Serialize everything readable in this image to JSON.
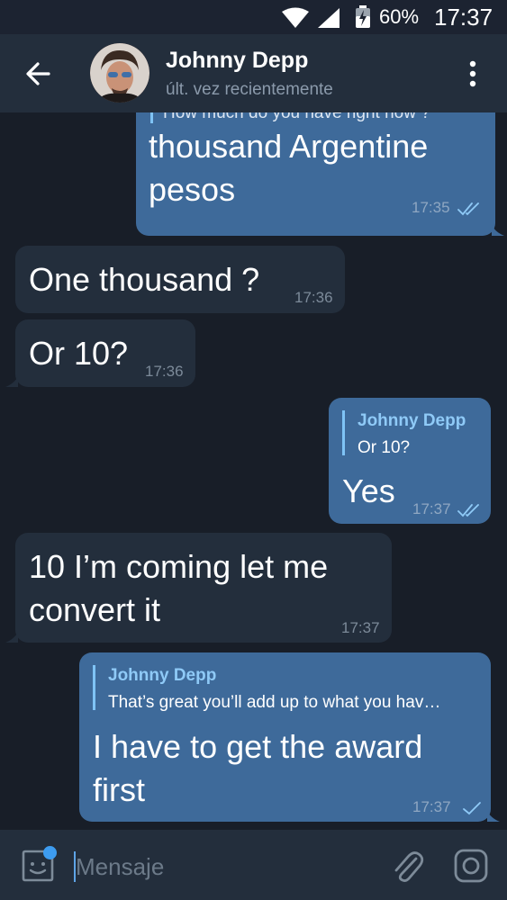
{
  "status_bar": {
    "battery_percent": "60%",
    "time": "17:37",
    "icons": [
      "wifi-icon",
      "signal-icon",
      "battery-charging-icon"
    ]
  },
  "header": {
    "contact_name": "Johnny Depp",
    "last_seen": "últ. vez recientemente",
    "icons": [
      "back-arrow-icon",
      "more-vert-icon"
    ]
  },
  "messages": [
    {
      "direction": "out",
      "reply": {
        "text": "How much do you have right now ?"
      },
      "text_lines": [
        "thousand Argentine",
        "pesos"
      ],
      "time": "17:35",
      "status": "read"
    },
    {
      "direction": "in",
      "text_lines": [
        "One thousand ?"
      ],
      "time": "17:36"
    },
    {
      "direction": "in",
      "text_lines": [
        "Or 10?"
      ],
      "time": "17:36"
    },
    {
      "direction": "out",
      "reply": {
        "name": "Johnny Depp",
        "text": "Or 10?"
      },
      "text_lines": [
        "Yes"
      ],
      "time": "17:37",
      "status": "read"
    },
    {
      "direction": "in",
      "text_lines": [
        "10 I’m coming let me",
        "convert it"
      ],
      "time": "17:37"
    },
    {
      "direction": "out",
      "reply": {
        "name": "Johnny Depp",
        "text": "That’s great you’ll add up to what you hav…"
      },
      "text_lines": [
        "I have to get the award",
        "first"
      ],
      "time": "17:37",
      "status": "sent"
    }
  ],
  "input": {
    "placeholder": "Mensaje",
    "icons": [
      "emoji-sticker-icon",
      "attach-icon",
      "camera-icon"
    ]
  },
  "colors": {
    "background": "#181e28",
    "header": "#232e3c",
    "outgoing_bubble": "#3e6a9a",
    "incoming_bubble": "#232e3c",
    "reply_accent": "#7fc3f5",
    "unread_dot": "#3d9cf0"
  }
}
